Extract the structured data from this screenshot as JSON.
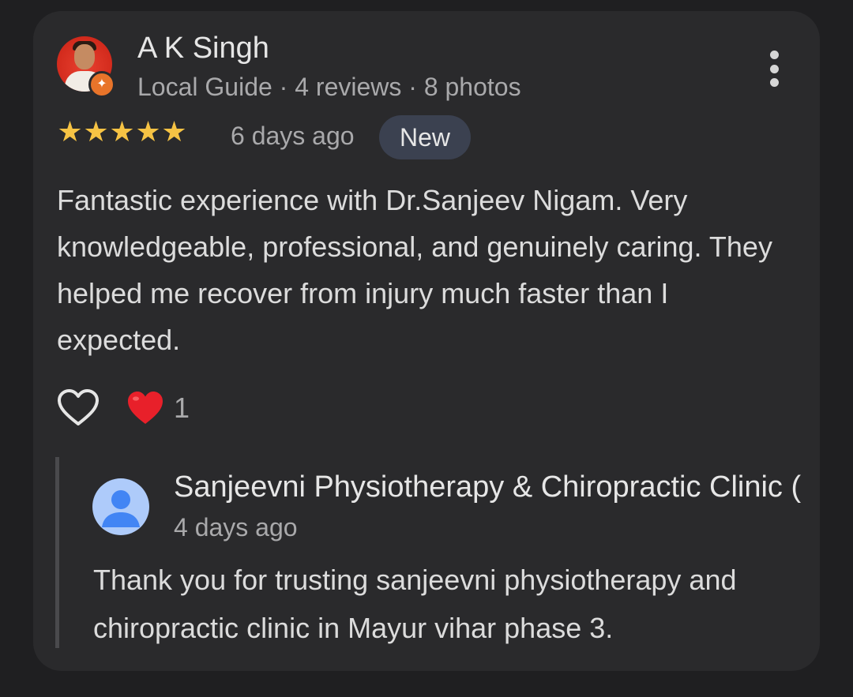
{
  "review": {
    "author": "A K Singh",
    "author_meta": "Local Guide · 4 reviews · 8 photos",
    "guide_badge_icon": "local-guide-star-icon",
    "rating": 5,
    "rating_max": 5,
    "stars": [
      "★",
      "★",
      "★",
      "★",
      "★"
    ],
    "date": "6 days ago",
    "badge": "New",
    "text": "Fantastic experience with Dr.Sanjeev Nigam. Very knowledgeable, professional, and genuinely caring. They helped me recover from injury much faster than I expected.",
    "reaction_icon": "red-heart-icon",
    "reaction_count": "1"
  },
  "reply": {
    "owner_name": "Sanjeevni Physiotherapy & Chiropractic Clinic (",
    "date": "4 days ago",
    "text": "Thank you for trusting sanjeevni physiotherapy and chiropractic clinic in Mayur vihar phase 3."
  },
  "colors": {
    "background": "#1f1f21",
    "card": "#2a2a2c",
    "star": "#f6c344",
    "badge_bg": "#3b4150",
    "heart": "#e8202a",
    "owner_avatar": "#aecbfa",
    "owner_avatar_figure": "#4285f4"
  }
}
